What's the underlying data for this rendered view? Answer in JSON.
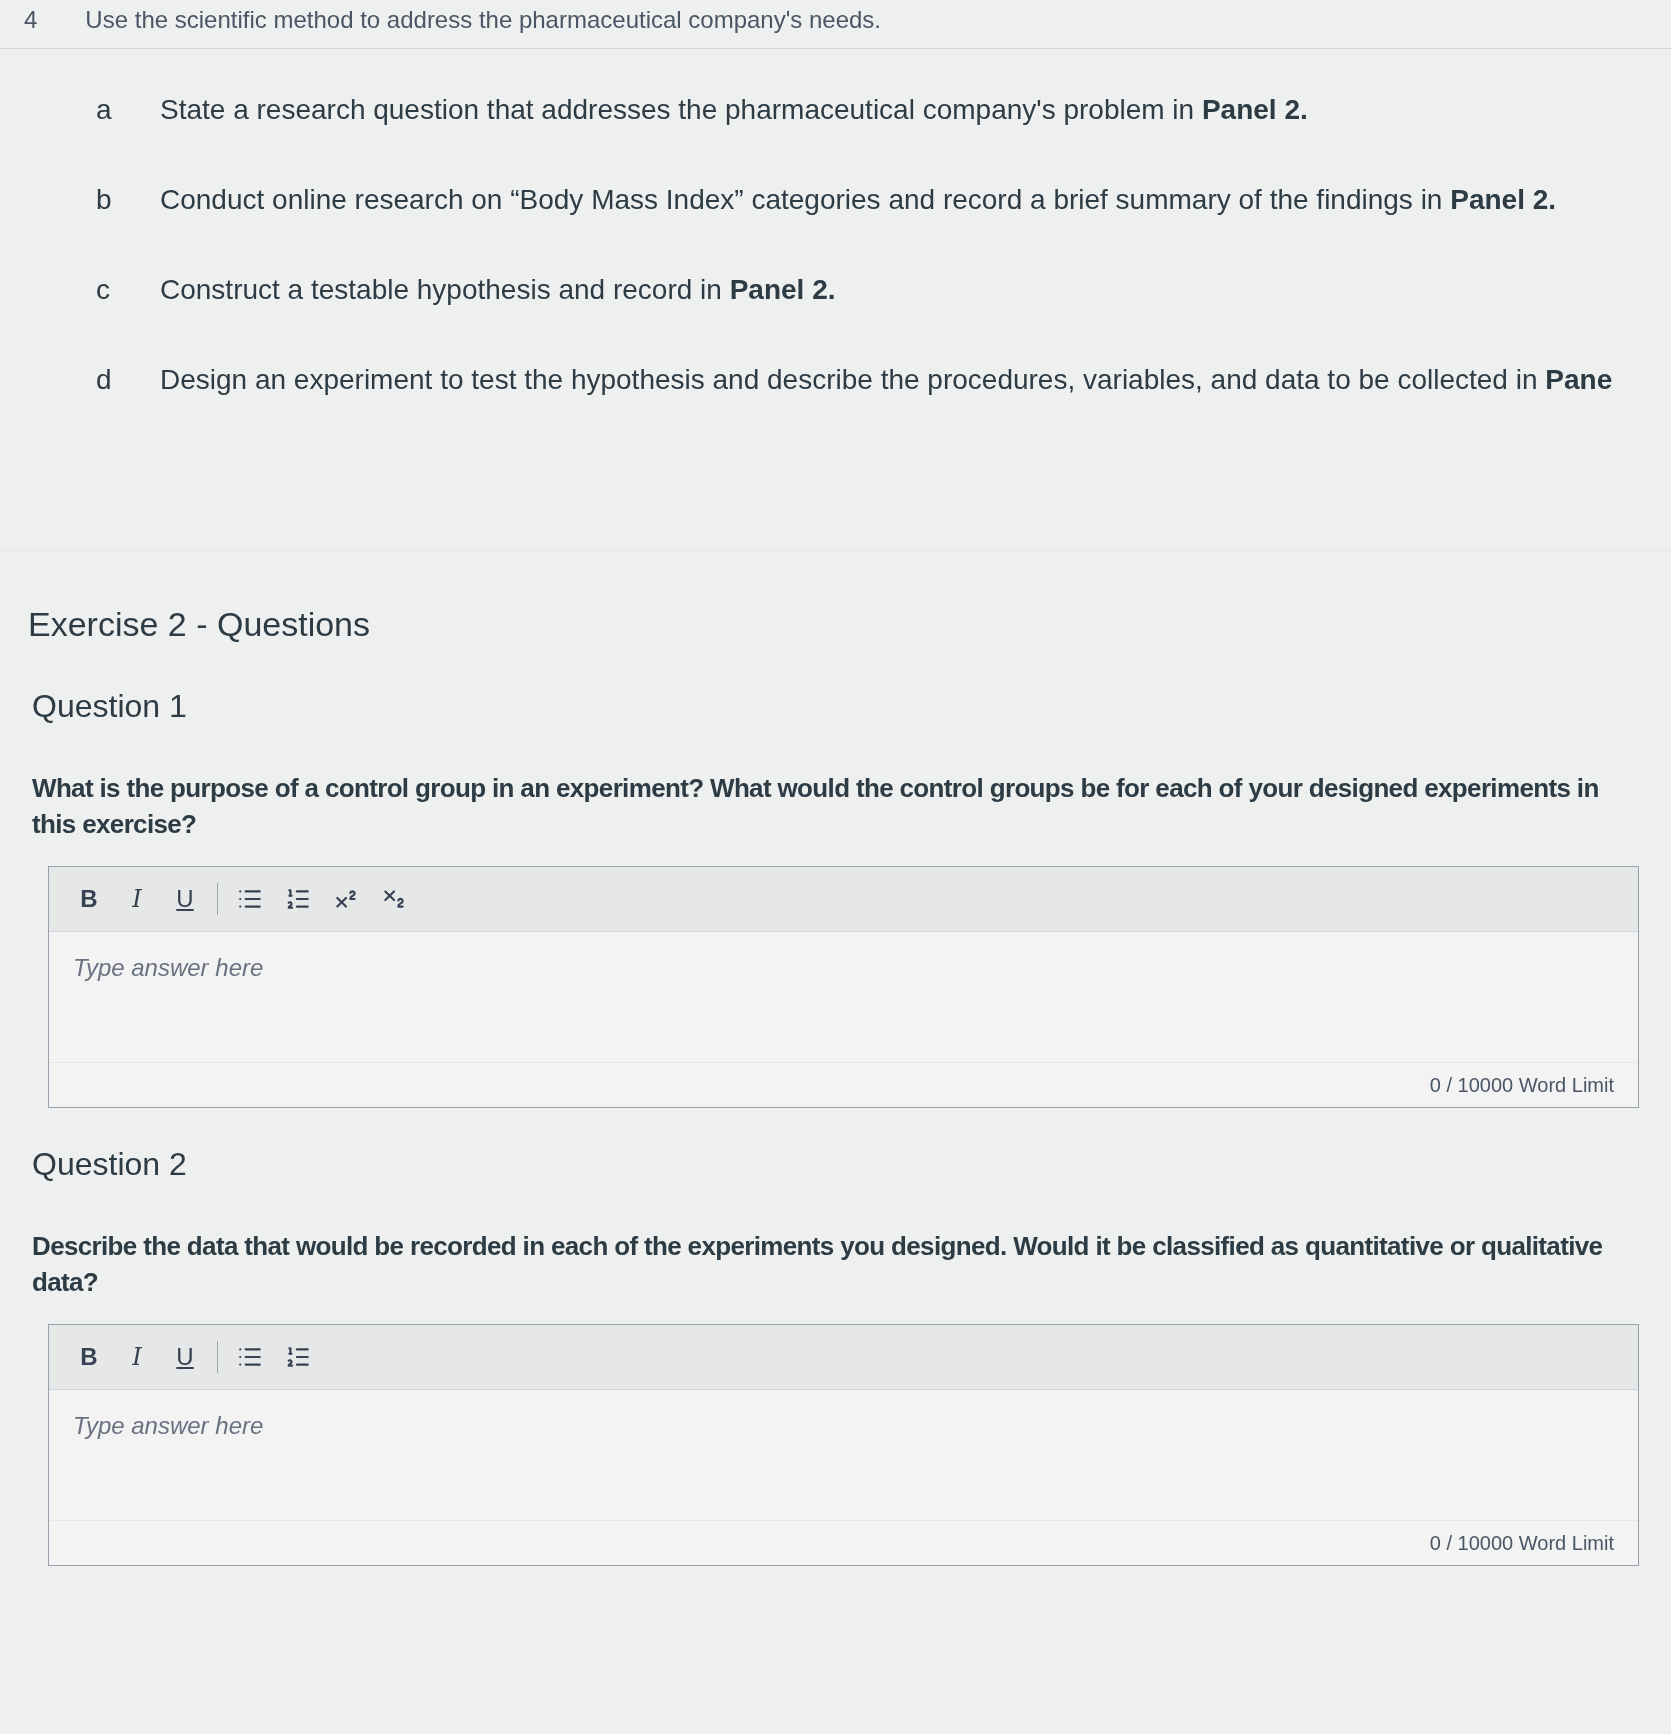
{
  "task": {
    "number": "4",
    "text": "Use the scientific method to address the pharmaceutical company's needs."
  },
  "subtasks": [
    {
      "letter": "a",
      "text": "State a research question that addresses the pharmaceutical company's problem in **Panel 2.**"
    },
    {
      "letter": "b",
      "text": "Conduct online research on “Body Mass Index” categories and record a brief summary of the findings in **Panel 2.**"
    },
    {
      "letter": "c",
      "text": "Construct a testable hypothesis and record in **Panel 2.**"
    },
    {
      "letter": "d",
      "text": "Design an experiment to test the hypothesis and describe the procedures, variables, and data to be collected in **Pane**"
    }
  ],
  "section_title": "Exercise 2 - Questions",
  "questions": [
    {
      "title": "Question 1",
      "prompt": "What is the purpose of a control group in an experiment? What would the control groups be for each of your designed experiments in this exercise?",
      "editor": {
        "toolbar": [
          {
            "kind": "bold",
            "label": "B"
          },
          {
            "kind": "italic",
            "label": "I"
          },
          {
            "kind": "underline",
            "label": "U"
          },
          {
            "kind": "separator"
          },
          {
            "kind": "bullet-list"
          },
          {
            "kind": "numbered-list"
          },
          {
            "kind": "superscript"
          },
          {
            "kind": "subscript"
          }
        ],
        "placeholder": "Type answer here",
        "word_count": "0 / 10000 Word Limit"
      }
    },
    {
      "title": "Question 2",
      "prompt": "Describe the data that would be recorded in each of the experiments you designed. Would it be classified as quantitative or qualitative data?",
      "editor": {
        "toolbar": [
          {
            "kind": "bold",
            "label": "B"
          },
          {
            "kind": "italic",
            "label": "I"
          },
          {
            "kind": "underline",
            "label": "U"
          },
          {
            "kind": "separator"
          },
          {
            "kind": "bullet-list"
          },
          {
            "kind": "numbered-list"
          }
        ],
        "placeholder": "Type answer here",
        "word_count": "0 / 10000 Word Limit"
      }
    }
  ]
}
